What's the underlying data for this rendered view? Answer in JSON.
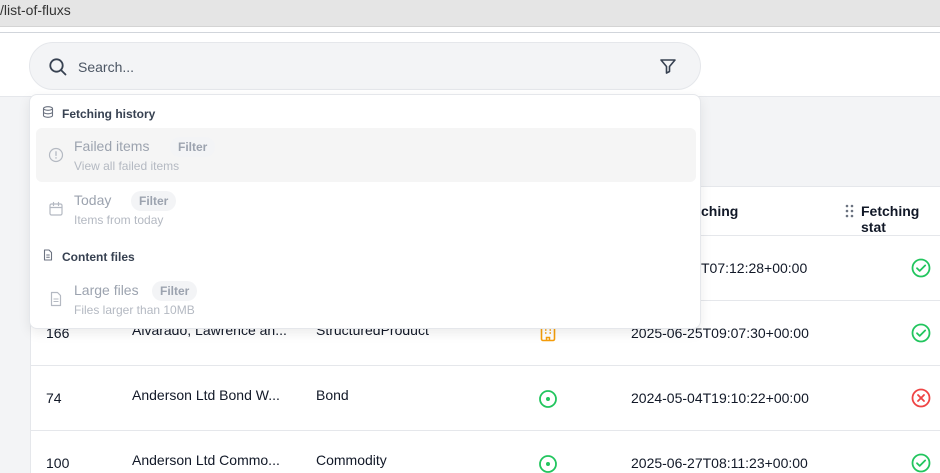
{
  "address_bar": {
    "text": "/list-of-fluxs"
  },
  "search": {
    "placeholder": "Search..."
  },
  "dropdown": {
    "groups": [
      {
        "label": "Fetching history",
        "icon": "database-icon",
        "items": [
          {
            "label": "Failed items",
            "badge": "Filter",
            "description": "View all failed items",
            "icon": "alert-circle-icon"
          },
          {
            "label": "Today",
            "badge": "Filter",
            "description": "Items from today",
            "icon": "calendar-icon"
          }
        ]
      },
      {
        "label": "Content files",
        "icon": "file-icon",
        "items": [
          {
            "label": "Large files",
            "badge": "Filter",
            "description": "Files larger than 10MB",
            "icon": "file-text-icon"
          }
        ]
      }
    ]
  },
  "table": {
    "headers": {
      "last_fetching": "ching",
      "fetching_status": "Fetching stat"
    },
    "rows": [
      {
        "id": "",
        "name": "",
        "type": "",
        "last_fetching": "T07:12:28+00:00",
        "status": "success"
      },
      {
        "id": "166",
        "name": "Alvarado, Lawrence an...",
        "type": "StructuredProduct",
        "type_icon": "building-icon",
        "last_fetching": "2025-06-25T09:07:30+00:00",
        "status": "success"
      },
      {
        "id": "74",
        "name": "Anderson Ltd Bond W...",
        "type": "Bond",
        "type_icon": "target-icon",
        "last_fetching": "2024-05-04T19:10:22+00:00",
        "status": "failed"
      },
      {
        "id": "100",
        "name": "Anderson Ltd Commo...",
        "type": "Commodity",
        "type_icon": "target-icon",
        "last_fetching": "2025-06-27T08:11:23+00:00",
        "status": "success"
      }
    ]
  },
  "colors": {
    "success": "#22c55e",
    "failed": "#ef4444",
    "structured_product": "#f59e0b",
    "target": "#22c55e"
  }
}
